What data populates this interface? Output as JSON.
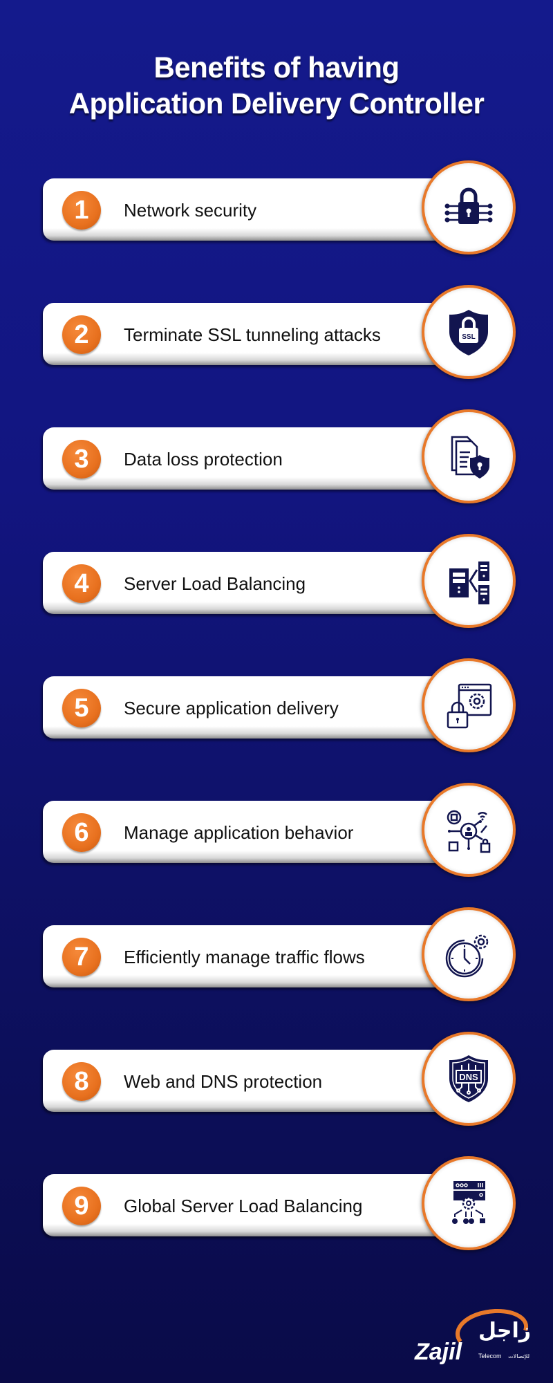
{
  "title": {
    "line1": "Benefits of having",
    "line2": "Application Delivery Controller"
  },
  "items": [
    {
      "number": "1",
      "label": "Network security",
      "icon": "circuit-lock-icon"
    },
    {
      "number": "2",
      "label": "Terminate SSL tunneling attacks",
      "icon": "ssl-shield-icon"
    },
    {
      "number": "3",
      "label": "Data loss protection",
      "icon": "document-shield-icon"
    },
    {
      "number": "4",
      "label": "Server Load Balancing",
      "icon": "server-load-balancing-icon"
    },
    {
      "number": "5",
      "label": "Secure application delivery",
      "icon": "app-lock-gear-icon"
    },
    {
      "number": "6",
      "label": "Manage application behavior",
      "icon": "user-network-icon"
    },
    {
      "number": "7",
      "label": "Efficiently manage traffic flows",
      "icon": "clock-gear-icon"
    },
    {
      "number": "8",
      "label": "Web and DNS protection",
      "icon": "dns-shield-icon"
    },
    {
      "number": "9",
      "label": "Global Server Load Balancing",
      "icon": "global-server-distribution-icon"
    }
  ],
  "logo": {
    "latin": "Zajil",
    "arabic": "زاجل",
    "tagline": "Telecom",
    "tagline_arabic": "للإتصالات"
  },
  "colors": {
    "background_top": "#141a8c",
    "background_bottom": "#0a0b48",
    "accent_orange": "#e8792a",
    "icon_navy": "#12154f",
    "text": "#111111"
  }
}
